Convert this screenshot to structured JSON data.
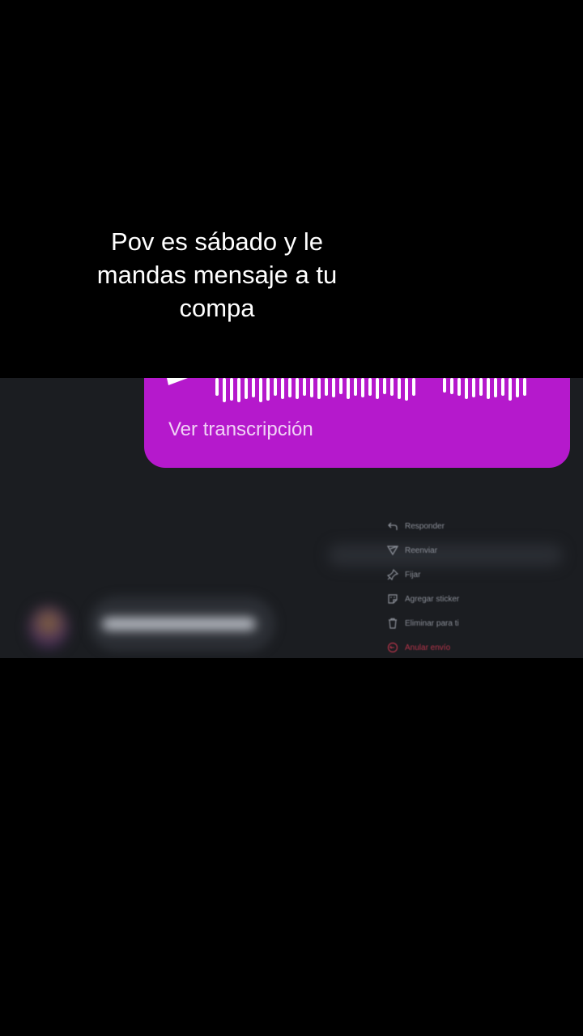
{
  "caption": "Pov es sábado y le mandas mensaje a tu compa",
  "voice_message": {
    "bubble_color": "#b519cc",
    "transcription_link": "Ver transcripción"
  },
  "context_menu": {
    "timestamp": "",
    "items": [
      {
        "label": "Responder",
        "icon": "reply-icon"
      },
      {
        "label": "Reenviar",
        "icon": "send-icon"
      },
      {
        "label": "Fijar",
        "icon": "pin-icon"
      },
      {
        "label": "Agregar sticker",
        "icon": "sticker-icon"
      },
      {
        "label": "Eliminar para ti",
        "icon": "trash-icon"
      },
      {
        "label": "Anular envío",
        "icon": "undo-icon",
        "danger": true
      }
    ]
  }
}
